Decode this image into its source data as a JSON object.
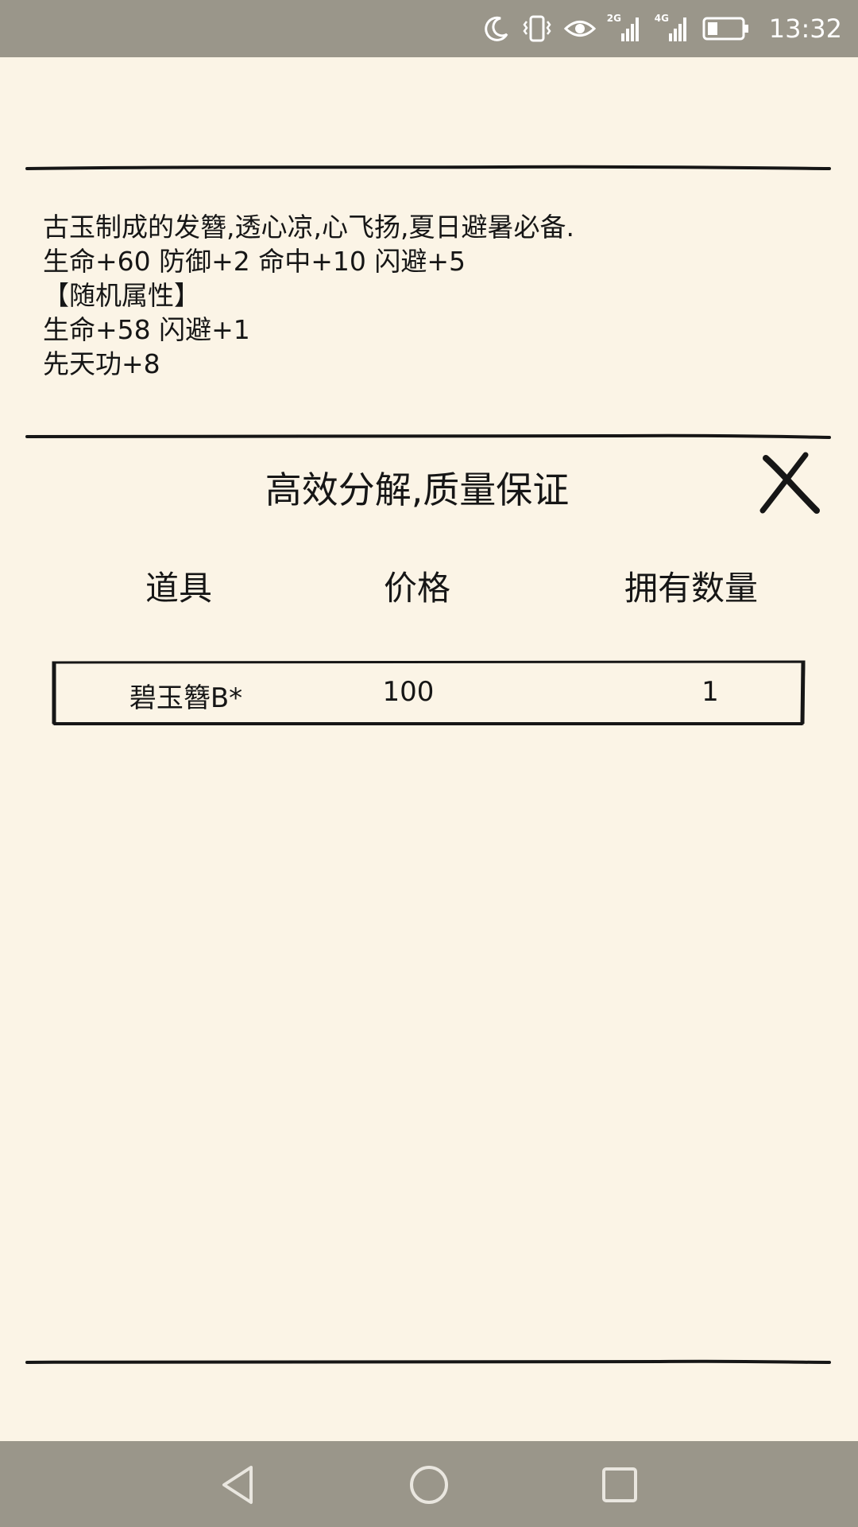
{
  "status_bar": {
    "time": "13:32",
    "net1": "2G",
    "net2": "4G",
    "icons": [
      "moon-icon",
      "vibrate-icon",
      "eye-icon",
      "signal-icon",
      "signal-icon",
      "battery-icon"
    ]
  },
  "item": {
    "description_lines": [
      "古玉制成的发簪,透心凉,心飞扬,夏日避暑必备.",
      "生命+60 防御+2 命中+10 闪避+5",
      "【随机属性】",
      "生命+58 闪避+1",
      "先天功+8"
    ]
  },
  "dialog": {
    "title": "高效分解,质量保证",
    "columns": [
      "道具",
      "价格",
      "拥有数量"
    ],
    "rows": [
      {
        "item": "碧玉簪B*",
        "price": "100",
        "quantity": "1"
      }
    ]
  },
  "colors": {
    "background": "#fbf4e6",
    "bars": "#9a968a",
    "ink": "#161616"
  }
}
